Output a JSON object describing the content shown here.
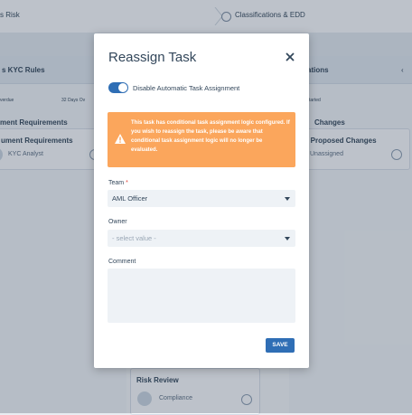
{
  "background": {
    "breadcrumbs": [
      "s Risk",
      "Classifications & EDD"
    ],
    "left_column": {
      "header": "s KYC Rules",
      "subrow_left": "verdue",
      "subrow_right": "32 Days Ov",
      "section_title": "ment Requirements",
      "card": {
        "title": "ument Requirements",
        "assignee": "KYC Analyst"
      }
    },
    "right_column": {
      "header": "ations",
      "subrow": "tarted",
      "section_title": "Changes",
      "card": {
        "title": "v Proposed Changes",
        "assignee": "Unassigned"
      }
    },
    "bottom_card": {
      "title": "Risk Review",
      "assignee": "Compliance"
    }
  },
  "modal": {
    "title": "Reassign Task",
    "toggle_label": "Disable Automatic Task Assignment",
    "toggle_on": true,
    "warning": "This task has conditional task assignment logic configured. If you wish to reassign the task, please be aware that conditional task assignment logic will no longer be evaluated.",
    "team_label": "Team",
    "team_required_mark": "*",
    "team_value": "AML Officer",
    "owner_label": "Owner",
    "owner_placeholder": "- select value -",
    "comment_label": "Comment",
    "comment_value": "",
    "save_label": "SAVE"
  },
  "colors": {
    "primary": "#2f6eb5",
    "warning": "#fba65c",
    "required": "#e0453a",
    "text": "#33475b"
  },
  "icons": [
    "chevron-right-icon",
    "close-icon",
    "warning-icon",
    "caret-down-icon",
    "user-avatar-icon"
  ]
}
